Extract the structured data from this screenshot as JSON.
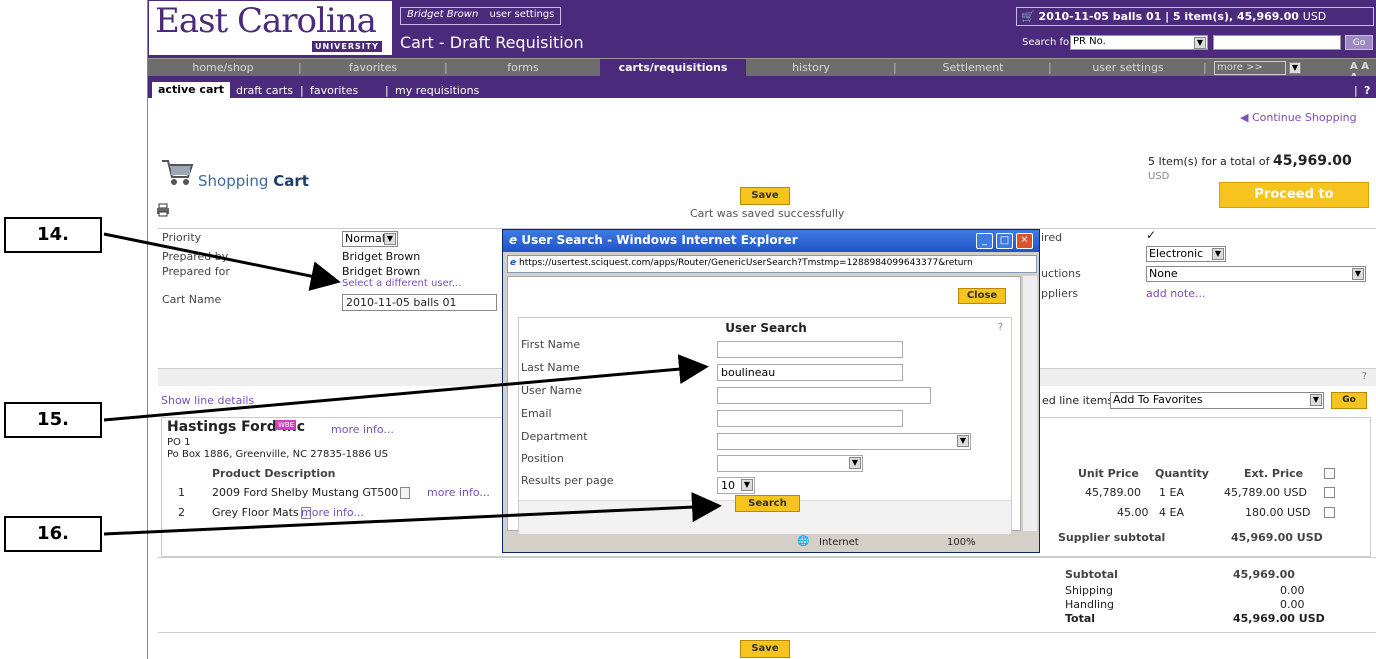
{
  "header": {
    "logo_main": "East Carolina",
    "logo_sub": "UNIVERSITY",
    "user_name": "Bridget Brown",
    "user_settings": "user settings",
    "page_title": "Cart - Draft Requisition",
    "cart_summary": "2010-11-05 balls 01 | 5 item(s), 45,969.00",
    "cart_currency": "USD",
    "search_label": "Search for",
    "search_select": "PR No.",
    "search_go": "Go"
  },
  "nav": {
    "items": [
      "home/shop",
      "favorites",
      "forms",
      "carts/requisitions",
      "history",
      "Settlement",
      "user settings"
    ],
    "more": "more >>",
    "font_size": "A A A"
  },
  "subnav": {
    "active": "active cart",
    "items": [
      "draft carts",
      "favorites",
      "my requisitions"
    ],
    "help": "?"
  },
  "cart": {
    "continue_shopping": "Continue Shopping",
    "title_a": "Shopping",
    "title_b": "Cart",
    "save": "Save",
    "saved_msg": "Cart was saved successfully",
    "total_prefix": "5 Item(s)  for a total of",
    "total_value": "45,969.00",
    "total_currency": "USD",
    "checkout": "Proceed to Checkout"
  },
  "form": {
    "priority_label": "Priority",
    "priority_value": "Normal",
    "prepared_by_label": "Prepared by",
    "prepared_by_value": "Bridget Brown",
    "prepared_for_label": "Prepared for",
    "prepared_for_value": "Bridget Brown",
    "select_user": "Select a different user...",
    "cart_name_label": "Cart Name",
    "cart_name_value": "2010-11-05 balls 01",
    "required_label": "ired",
    "delivery_value": "Electronic",
    "instructions_label": "uctions",
    "instructions_value": "None",
    "suppliers_label": "ppliers",
    "add_note": "add note..."
  },
  "items": {
    "show_line_details": "Show line details",
    "selected_label": "ed line items",
    "action_value": "Add To Favorites",
    "go": "Go",
    "help": "?",
    "supplier_name": "Hastings Ford Inc",
    "supplier_badge": "WBE",
    "supplier_more": "more info...",
    "supplier_addr1": "PO 1",
    "supplier_addr2": "Po Box 1886, Greenville, NC 27835-1886 US",
    "col_desc": "Product Description",
    "col_unit": "Unit Price",
    "col_qty": "Quantity",
    "col_ext": "Ext. Price",
    "rows": [
      {
        "num": "1",
        "desc": "2009 Ford Shelby Mustang GT500",
        "more": "more info...",
        "unit": "45,789.00",
        "qty": "1 EA",
        "ext": "45,789.00 USD"
      },
      {
        "num": "2",
        "desc": "Grey Floor Mats",
        "more": "more info...",
        "unit": "45.00",
        "qty": "4 EA",
        "ext": "180.00 USD"
      }
    ],
    "supplier_subtotal_label": "Supplier subtotal",
    "supplier_subtotal_value": "45,969.00 USD"
  },
  "totals": {
    "subtotal_label": "Subtotal",
    "subtotal_value": "45,969.00",
    "shipping_label": "Shipping",
    "shipping_value": "0.00",
    "handling_label": "Handling",
    "handling_value": "0.00",
    "total_label": "Total",
    "total_value": "45,969.00 USD"
  },
  "popup": {
    "title": "User Search - Windows Internet Explorer",
    "url": "https://usertest.sciquest.com/apps/Router/GenericUserSearch?Tmstmp=1288984099643377&return",
    "close": "Close",
    "heading": "User Search",
    "help": "?",
    "first_name_label": "First Name",
    "last_name_label": "Last Name",
    "last_name_value": "boulineau",
    "user_name_label": "User Name",
    "email_label": "Email",
    "department_label": "Department",
    "position_label": "Position",
    "results_label": "Results per page",
    "results_value": "10",
    "search": "Search",
    "status_zone": "Internet",
    "status_zoom": "100%"
  },
  "callouts": [
    "14.",
    "15.",
    "16."
  ]
}
